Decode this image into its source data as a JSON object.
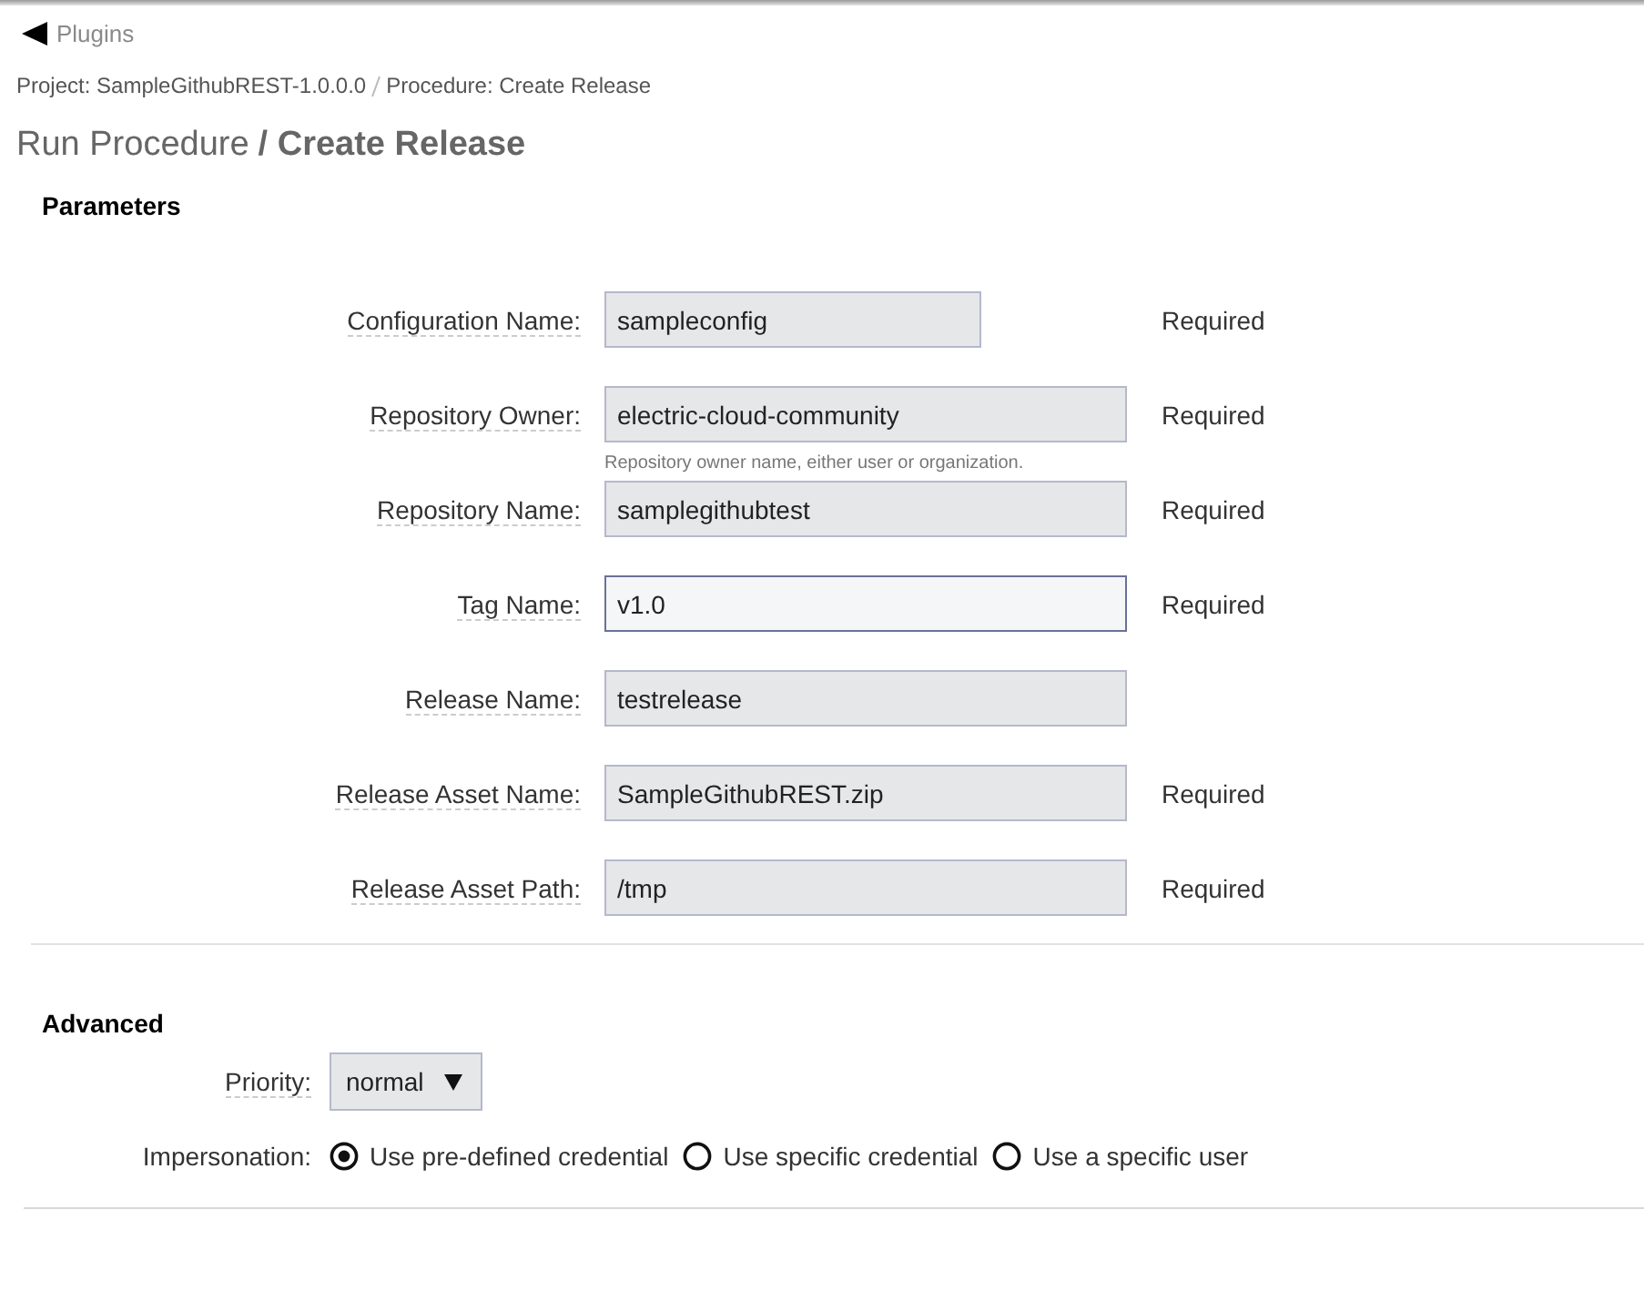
{
  "back_link": {
    "label": "Plugins"
  },
  "breadcrumb": [
    {
      "label": "Project: SampleGithubREST-1.0.0.0"
    },
    {
      "label": "Procedure: Create Release"
    }
  ],
  "title": {
    "prefix": "Run Procedure",
    "main": "/ Create Release"
  },
  "parameters": {
    "heading": "Parameters",
    "fields": [
      {
        "label": "Configuration Name:",
        "value": "sampleconfig",
        "kind": "short",
        "required": "Required",
        "focused": false
      },
      {
        "label": "Repository Owner:",
        "value": "electric-cloud-community",
        "kind": "long",
        "required": "Required",
        "help": "Repository owner name, either user or organization.",
        "focused": false
      },
      {
        "label": "Repository Name:",
        "value": "samplegithubtest",
        "kind": "long",
        "required": "Required",
        "focused": false
      },
      {
        "label": "Tag Name:",
        "value": "v1.0",
        "kind": "long",
        "required": "Required",
        "focused": true
      },
      {
        "label": "Release Name:",
        "value": "testrelease",
        "kind": "long",
        "focused": false
      },
      {
        "label": "Release Asset Name:",
        "value": "SampleGithubREST.zip",
        "kind": "long",
        "required": "Required",
        "focused": false
      },
      {
        "label": "Release Asset Path:",
        "value": "/tmp",
        "kind": "long",
        "required": "Required",
        "focused": false
      }
    ]
  },
  "advanced": {
    "heading": "Advanced",
    "priority": {
      "label": "Priority:",
      "value": "normal"
    },
    "impersonation": {
      "label": "Impersonation:",
      "options": [
        {
          "label": "Use pre-defined credential",
          "selected": true
        },
        {
          "label": "Use specific credential",
          "selected": false
        },
        {
          "label": "Use a specific user",
          "selected": false
        }
      ]
    }
  }
}
